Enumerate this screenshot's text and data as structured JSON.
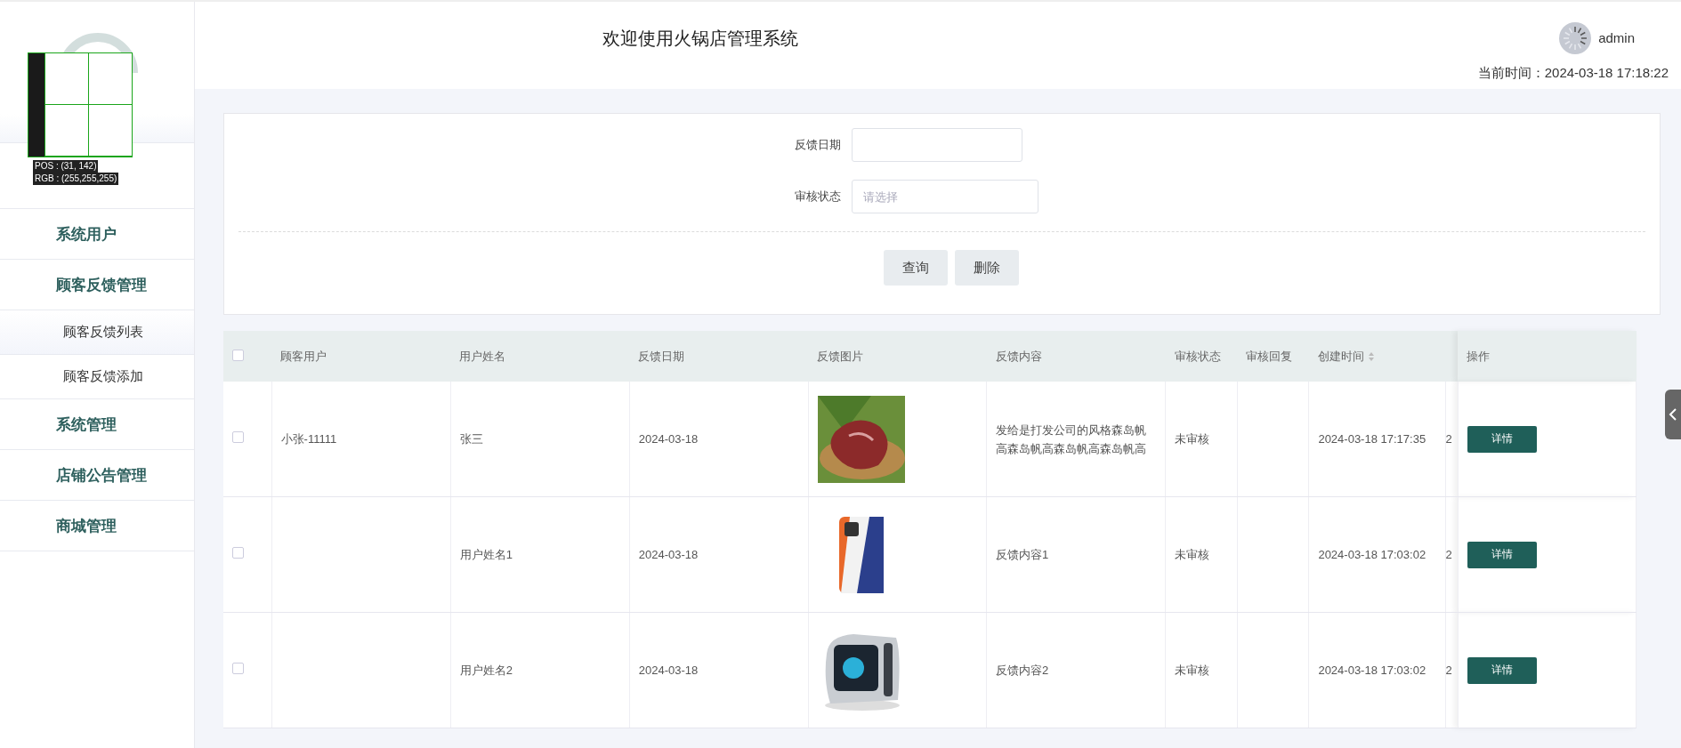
{
  "header": {
    "title": "欢迎使用火锅店管理系统",
    "user": "admin",
    "time_label": "当前时间：2024-03-18 17:18:22"
  },
  "picker_overlay": {
    "pos": "POS : (31, 142)",
    "rgb": "RGB : (255,255,255)"
  },
  "sidebar": {
    "items": [
      {
        "label": "系统用户"
      },
      {
        "label": "顾客反馈管理",
        "children": [
          {
            "label": "顾客反馈列表",
            "selected": true
          },
          {
            "label": "顾客反馈添加",
            "selected": false
          }
        ]
      },
      {
        "label": "系统管理"
      },
      {
        "label": "店铺公告管理"
      },
      {
        "label": "商城管理"
      }
    ]
  },
  "filters": [
    {
      "label": "反馈日期",
      "kind": "date"
    },
    {
      "label": "审核状态",
      "kind": "select",
      "placeholder": "请选择"
    }
  ],
  "filter_buttons": [
    "查询",
    "删除"
  ],
  "table": {
    "all_checked": false,
    "columns": [
      {
        "kind": "check"
      },
      {
        "label": "顾客用户",
        "kind": "text"
      },
      {
        "label": "用户姓名",
        "kind": "text"
      },
      {
        "label": "反馈日期",
        "kind": "text"
      },
      {
        "label": "反馈图片"
      },
      {
        "label": "反馈内容",
        "kind": "text"
      },
      {
        "label": "审核状态",
        "kind": "narrow"
      },
      {
        "label": "审核回复",
        "kind": "narrow"
      },
      {
        "label": "创建时间",
        "kind": "sorted"
      },
      {
        "kind": "cut"
      },
      {
        "label": "操作",
        "kind": "action"
      }
    ],
    "rows": [
      {
        "cells": [
          {
            "kind": "checkbox",
            "checked": false
          },
          "小张-11111",
          "张三",
          "2024-03-18",
          {
            "kind": "picture"
          },
          "发给是打发公司的风格森岛帆高森岛帆高森岛帆高森岛帆高",
          "未审核",
          "",
          "2024-03-18 17:17:35",
          "2",
          "详情"
        ]
      },
      {
        "cells": [
          {
            "kind": "checkbox",
            "checked": false
          },
          "",
          "用户姓名1",
          "2024-03-18",
          {
            "kind": "picture"
          },
          "反馈内容1",
          "未审核",
          "",
          "2024-03-18 17:03:02",
          "2",
          "详情"
        ]
      },
      {
        "cells": [
          {
            "kind": "checkbox",
            "checked": false
          },
          "",
          "用户姓名2",
          "2024-03-18",
          {
            "kind": "picture"
          },
          "反馈内容2",
          "未审核",
          "",
          "2024-03-18 17:03:02",
          "2",
          "详情"
        ]
      }
    ]
  }
}
